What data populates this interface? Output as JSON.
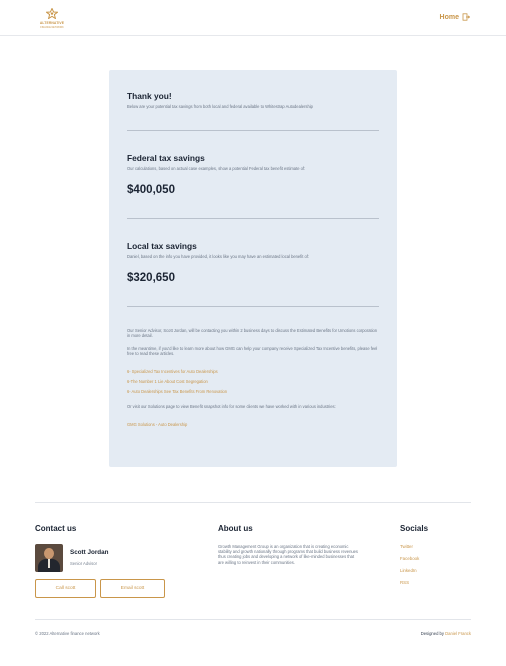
{
  "header": {
    "logo_text": "ALTERNATIVE",
    "logo_sub": "FINANCE NETWORK",
    "home_label": "Home"
  },
  "card": {
    "thanks_title": "Thank you!",
    "thanks_sub": "Below are your potential tax savings from both local and federal available to Whitestrap Autodealership",
    "federal_title": "Federal tax savings",
    "federal_sub": "Our calculations, based on actual case examples, show a potential Federal tax benefit estimate of:",
    "federal_amount": "$400,050",
    "local_title": "Local tax savings",
    "local_sub": "Daniel, based on the info you have provided, it looks like you may have an estimated local benefit of:",
    "local_amount": "$320,650",
    "advisor_para": "Our Senior Advisor, Scott Jordan, will be contacting you within 2 business days to discuss the Estimated Benefits for Umotions corporation in more detail.",
    "meantime_para": "In the meantime, if you'd like to learn more about how GMG can help your company receive Specialized Tax Incentive benefits, please feel free to read these articles.",
    "articles": [
      "6- Specialized Tax Incentives for Auto Dealerships",
      "6-The Number 1 Lie About Cost Segregation",
      "6- Auto Dealerships See Tax Benefits From Renovation"
    ],
    "solutions_para": "Or visit our Solutions page to view Benefit snapshot info for some clients we have worked with in various industries:",
    "solutions_link": "GMG Solutions - Auto Dealership"
  },
  "footer": {
    "contact_title": "Contact us",
    "advisor_name": "Scott Jordan",
    "advisor_role": "Senior Advisor",
    "call_label": "Call scott",
    "email_label": "Email scott",
    "about_title": "About us",
    "about_text": "Growth Management Group is an organization that is creating economic stability and growth nationally through programs that build business revenues thus creating jobs and developing a network of like-minded businesses that are willing to reinvest in their communities.",
    "socials_title": "Socials",
    "socials": [
      "Twitter",
      "Facebook",
      "LinkedIn",
      "RSS"
    ],
    "copyright": "© 2022 Alternative finance network",
    "designed_by_prefix": "Designed by",
    "designer": "Daniel Franck"
  },
  "colors": {
    "accent": "#c9964a",
    "card_bg": "#e4ebf3",
    "heading": "#1b2433",
    "body_text": "#6a7585"
  },
  "icons": {
    "logo": "star-shield-logo-icon",
    "home": "exit-door-icon"
  }
}
